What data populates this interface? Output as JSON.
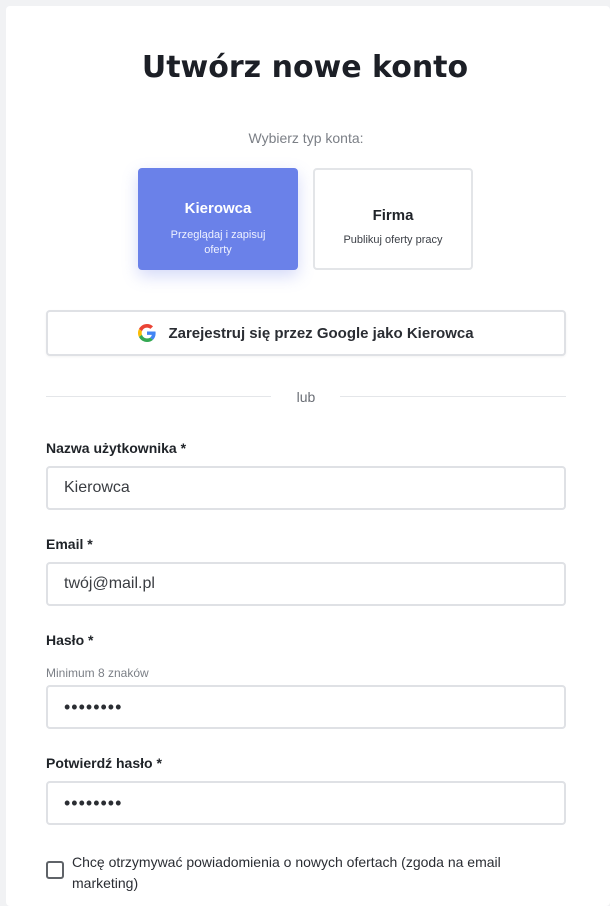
{
  "page": {
    "title": "Utwórz nowe konto",
    "account_type_prompt": "Wybierz typ konta:"
  },
  "account_types": [
    {
      "title": "Kierowca",
      "subtitle": "Przeglądaj i zapisuj oferty",
      "selected": true
    },
    {
      "title": "Firma",
      "subtitle": "Publikuj oferty pracy",
      "selected": false
    }
  ],
  "google_signup": {
    "label": "Zarejestruj się przez Google jako Kierowca",
    "icon": "google-logo-icon"
  },
  "divider_text": "lub",
  "form": {
    "username": {
      "label": "Nazwa użytkownika *",
      "value": "Kierowca"
    },
    "email": {
      "label": "Email *",
      "value": "twój@mail.pl"
    },
    "password": {
      "label": "Hasło *",
      "hint": "Minimum 8 znaków",
      "value": "••••••••"
    },
    "confirm_password": {
      "label": "Potwierdź hasło *",
      "value": "••••••••"
    },
    "marketing_consent": {
      "label": "Chcę otrzymywać powiadomienia o nowych ofertach (zgoda na email marketing)",
      "checked": false
    }
  },
  "colors": {
    "accent": "#6a81e9",
    "border": "#dfe1e5",
    "background": "#f1f2f4"
  }
}
